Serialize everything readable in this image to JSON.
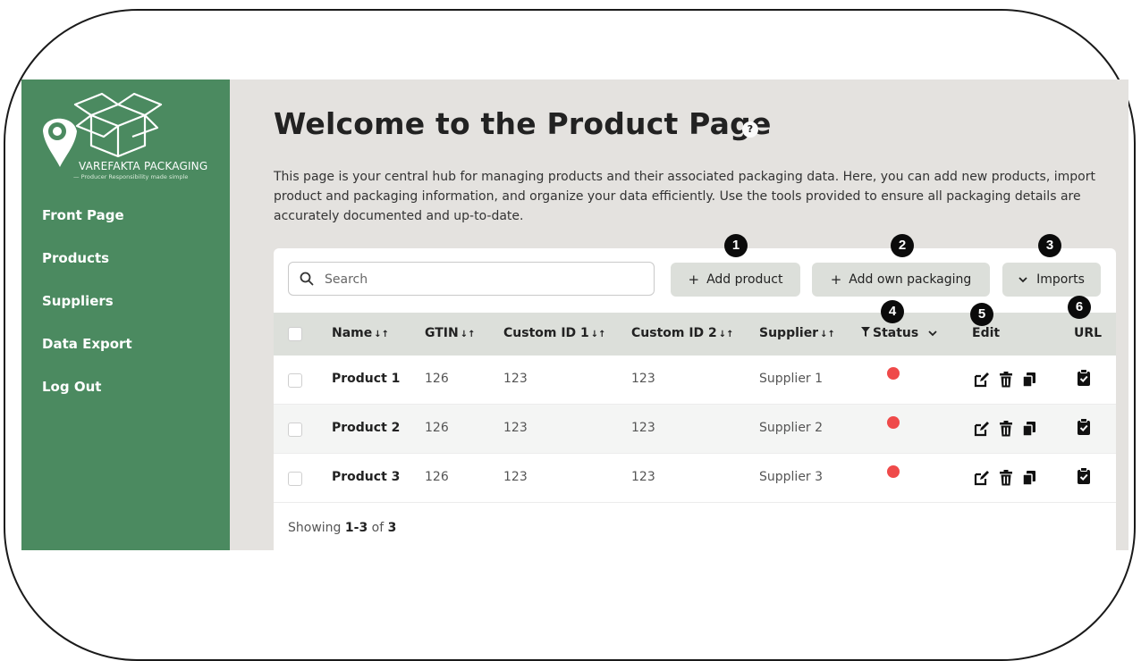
{
  "sidebar": {
    "brand_name": "VAREFAKTA PACKAGING",
    "brand_tagline": "— Producer Responsibility made simple",
    "nav": [
      "Front Page",
      "Products",
      "Suppliers",
      "Data Export",
      "Log Out"
    ]
  },
  "header": {
    "title": "Welcome to the Product Page",
    "help": "?",
    "intro": "This page is your central hub for managing products and their associated packaging data. Here, you can add new products, import product and packaging information, and organize your data efficiently. Use the tools provided to ensure all packaging details are accurately documented and up-to-date."
  },
  "toolbar": {
    "search_placeholder": "Search",
    "add_product": "Add product",
    "add_packaging": "Add own packaging",
    "imports": "Imports"
  },
  "table": {
    "columns": {
      "name": "Name",
      "gtin": "GTIN",
      "custom1": "Custom ID 1",
      "custom2": "Custom ID 2",
      "supplier": "Supplier",
      "status": "Status",
      "edit": "Edit",
      "url": "URL"
    },
    "rows": [
      {
        "name": "Product 1",
        "gtin": "126",
        "custom1": "123",
        "custom2": "123",
        "supplier": "Supplier 1",
        "status": "red"
      },
      {
        "name": "Product 2",
        "gtin": "126",
        "custom1": "123",
        "custom2": "123",
        "supplier": "Supplier 2",
        "status": "red"
      },
      {
        "name": "Product 3",
        "gtin": "126",
        "custom1": "123",
        "custom2": "123",
        "supplier": "Supplier 3",
        "status": "red"
      }
    ],
    "footer": {
      "prefix": "Showing",
      "range": "1-3",
      "of": "of",
      "total": "3"
    }
  },
  "markers": [
    "1",
    "2",
    "3",
    "4",
    "5",
    "6"
  ],
  "colors": {
    "sidebar": "#4b8a60",
    "status_red": "#ef4a4a",
    "button_bg": "#dcdfda"
  },
  "icons": [
    "search-icon",
    "plus-icon",
    "chevron-down-icon",
    "sort-icon",
    "filter-icon",
    "edit-icon",
    "trash-icon",
    "copy-icon",
    "clipboard-check-icon"
  ]
}
